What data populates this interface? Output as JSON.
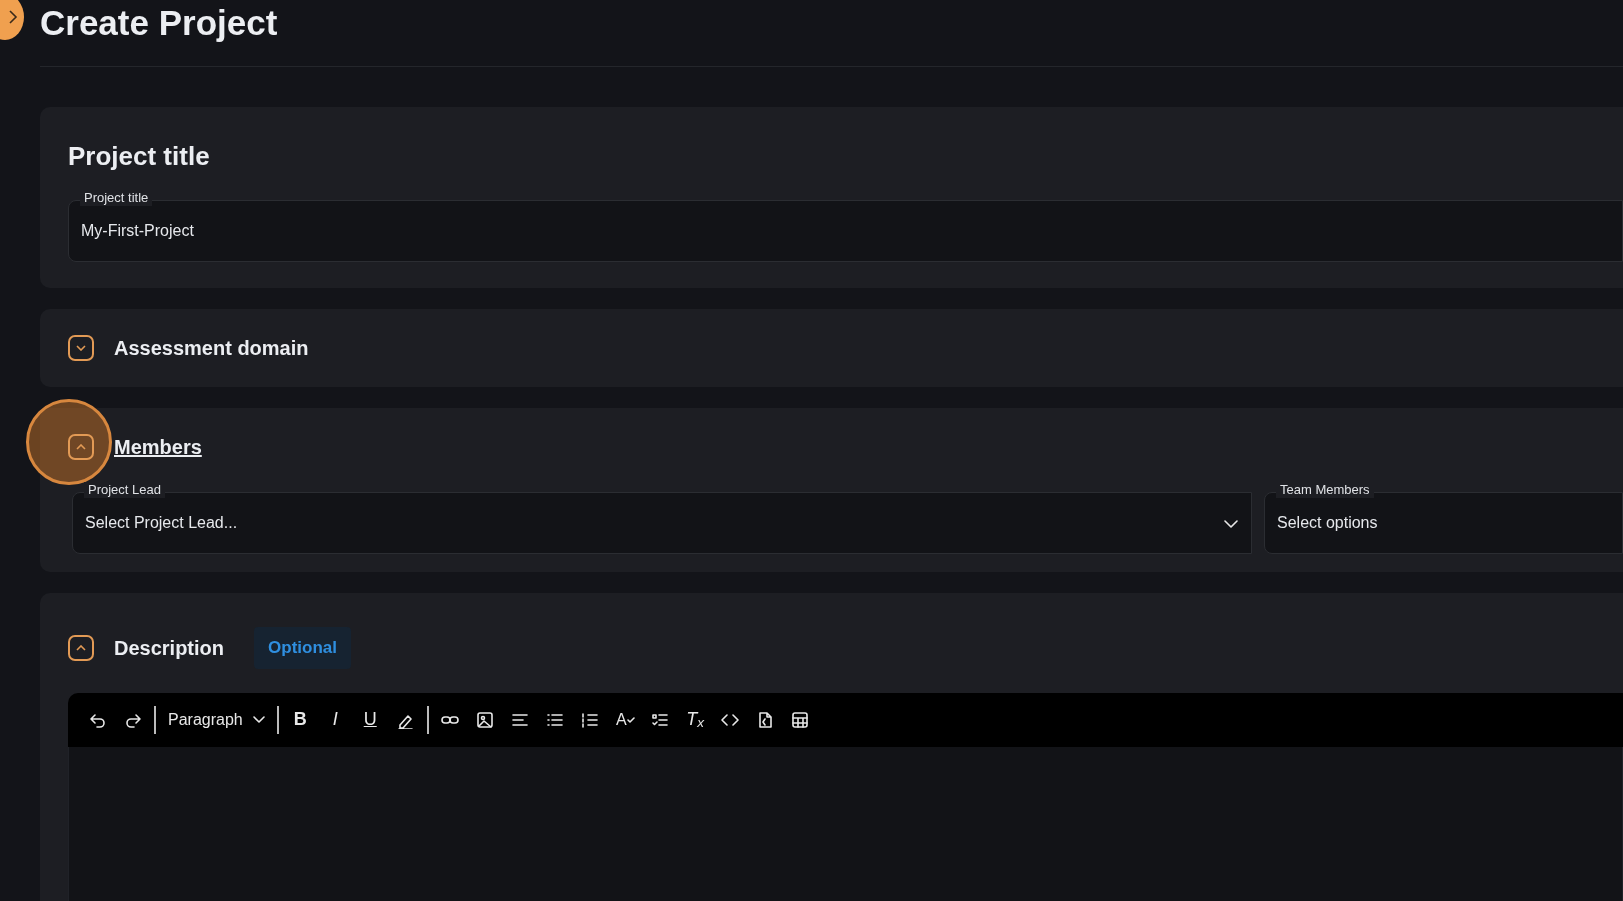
{
  "page": {
    "title": "Create Project"
  },
  "title_card": {
    "heading": "Project title",
    "field": {
      "label": "Project title",
      "value": "My-First-Project"
    }
  },
  "sections": [
    {
      "kind": "plain",
      "title": "Assessment domain",
      "expanded": false,
      "hovered": false
    },
    {
      "kind": "members",
      "title": "Members",
      "expanded": true,
      "hovered": true,
      "fields": [
        {
          "label": "Project Lead",
          "placeholder": "Select Project Lead...",
          "dropdown": true
        },
        {
          "label": "Team Members",
          "placeholder": "Select options",
          "dropdown": false
        }
      ]
    },
    {
      "kind": "editor",
      "title": "Description",
      "expanded": true,
      "hovered": false,
      "badge": "Optional",
      "toolbar": [
        {
          "kind": "undo"
        },
        {
          "kind": "redo"
        },
        {
          "kind": "separator"
        },
        {
          "kind": "dropdown",
          "label": "Paragraph"
        },
        {
          "kind": "separator"
        },
        {
          "kind": "bold",
          "label": "B"
        },
        {
          "kind": "italic",
          "label": "I"
        },
        {
          "kind": "underline",
          "label": "U"
        },
        {
          "kind": "highlight"
        },
        {
          "kind": "separator"
        },
        {
          "kind": "link"
        },
        {
          "kind": "image"
        },
        {
          "kind": "align"
        },
        {
          "kind": "bullets"
        },
        {
          "kind": "numbers"
        },
        {
          "kind": "spellcheck",
          "label": "A"
        },
        {
          "kind": "checklist"
        },
        {
          "kind": "clear",
          "label": "T$_{x}$"
        },
        {
          "kind": "code"
        },
        {
          "kind": "source"
        },
        {
          "kind": "table"
        }
      ]
    }
  ]
}
